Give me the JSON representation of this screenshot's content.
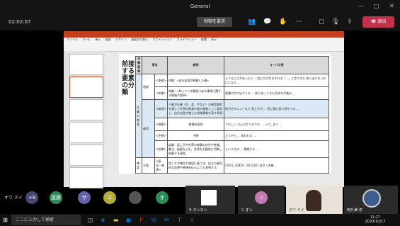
{
  "window": {
    "title": "General",
    "minimize": "—",
    "maximize": "□",
    "close": "✕"
  },
  "call": {
    "elapsed": "02:02:07",
    "request_control": "制御を要求",
    "leave": "退出"
  },
  "slide": {
    "left_title": "前接する要素の分類",
    "headers": [
      "分類基準",
      "用法",
      "説明",
      "コーパス例"
    ],
    "rows": [
      {
        "cat": "",
        "sub": "感起",
        "use": "<体験>",
        "desc": "体験：«自分自身が経験した事»",
        "ex": "ようなことがあったら 一笑に付されるそれは「...」と言うのも 思い出すきっかけになり ..."
      },
      {
        "cat": "",
        "sub": "",
        "use": "<知識>",
        "desc": "知識：«知っている範囲である事柄に関する情報や説明»",
        "ex": "話題の中で出てくる ... 知らないうちに気持ちが乗る ..."
      },
      {
        "cat": "",
        "sub": "",
        "use": "<知覚>",
        "desc": "人間が五感（目、耳、手など）の感覚器官を通じて外界の刺激を脳の情報として認知し、自分自身が感じた知覚事象を表す表現",
        "ex": "昨日そのニュースで 音とかが ... 急に頭に思い浮かべる ..."
      },
      {
        "cat": "広義の感覚",
        "sub": "感覚",
        "use": "<感情>",
        "desc": "感情的容詞",
        "ex": "うれしい なんだかうきうき ... ってしまう ..."
      },
      {
        "cat": "",
        "sub": "",
        "use": "<予想>",
        "desc": "予想",
        "ex": "どうやら ... 思われる ..."
      },
      {
        "cat": "",
        "sub": "",
        "use": "<認識>",
        "desc": "認識：話し手が外界の物事の存在や性質、働き、価値などを、言語を主観的に判断し把握する過程",
        "ex": "というのは ... 実感する ..."
      },
      {
        "cat": "確実",
        "sub": "主張",
        "use": "<意見・感想>",
        "desc": "話し手が確信や確認に基づき、自分の意見的な思想や感想を伝えようと表明する",
        "ex": "(2012_20850 : 952287) 宮武・秀樹 ..."
      }
    ]
  },
  "owa_label": "オワ ネイ",
  "participants": [
    {
      "initial": "+8",
      "color": "#464775"
    },
    {
      "initial": "遠藤",
      "color": "#2d8a5a"
    },
    {
      "initial": "サ",
      "color": "#6264a7"
    },
    {
      "initial": "エ",
      "color": "#b0ae34"
    },
    {
      "initial": "オ",
      "color": "#2e8b57"
    },
    {
      "initial": "リ",
      "color": "#c47ab0"
    }
  ],
  "tiles": [
    {
      "name": "ラ クンカン"
    },
    {
      "name": "リ オン"
    },
    {
      "name": "オワ ネイ"
    },
    {
      "name": "阿久津 淳"
    }
  ],
  "taskbar": {
    "search_placeholder": "ここに入力して検索",
    "time": "11:27",
    "date": "2020/10/17"
  }
}
